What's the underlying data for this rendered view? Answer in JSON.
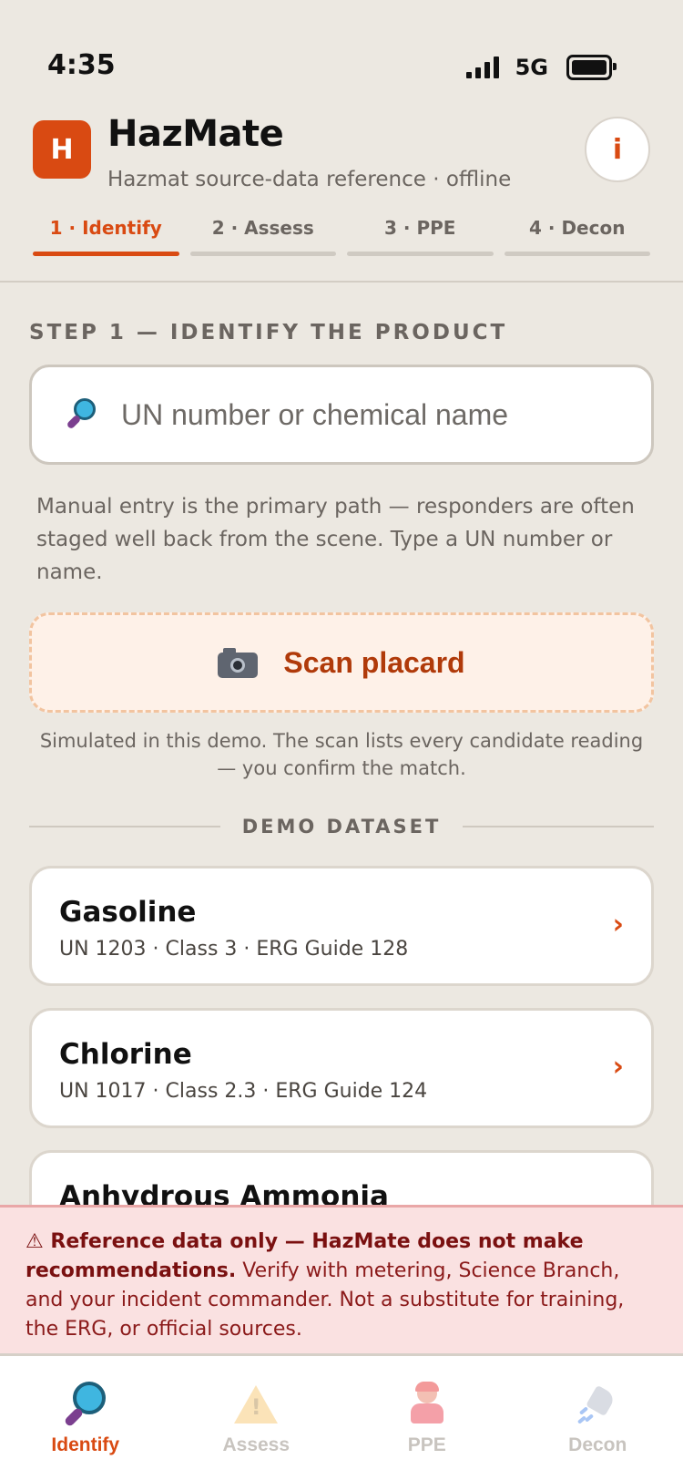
{
  "status_bar": {
    "time": "4:35",
    "network": "5G"
  },
  "header": {
    "logo_letter": "H",
    "title": "HazMate",
    "subtitle": "Hazmat source-data reference · offline",
    "info_label": "i"
  },
  "steps": [
    {
      "label": "1 · Identify",
      "active": true
    },
    {
      "label": "2 · Assess",
      "active": false
    },
    {
      "label": "3 · PPE",
      "active": false
    },
    {
      "label": "4 · Decon",
      "active": false
    }
  ],
  "identify": {
    "heading": "STEP 1 — IDENTIFY THE PRODUCT",
    "search_placeholder": "UN number or chemical name",
    "helper": "Manual entry is the primary path — responders are often staged well back from the scene. Type a UN number or name.",
    "scan_label": "Scan placard",
    "scan_note": "Simulated in this demo. The scan lists every candidate reading — you confirm the match."
  },
  "dataset": {
    "label": "DEMO DATASET",
    "items": [
      {
        "name": "Gasoline",
        "detail": "UN 1203 · Class 3 · ERG Guide 128"
      },
      {
        "name": "Chlorine",
        "detail": "UN 1017 · Class 2.3 · ERG Guide 124"
      },
      {
        "name": "Anhydrous Ammonia",
        "detail": ""
      }
    ],
    "chevron": "›"
  },
  "disclaimer": {
    "bold": "⚠ Reference data only — HazMate does not make recommendations.",
    "text": " Verify with metering, Science Branch, and your incident commander. Not a substitute for training, the ERG, or official sources."
  },
  "bottom_nav": [
    {
      "label": "Identify",
      "icon": "magnifier-icon",
      "active": true
    },
    {
      "label": "Assess",
      "icon": "warning-icon",
      "active": false
    },
    {
      "label": "PPE",
      "icon": "responder-icon",
      "active": false
    },
    {
      "label": "Decon",
      "icon": "shower-icon",
      "active": false
    }
  ],
  "colors": {
    "accent": "#D94A12",
    "background": "#ECE8E1",
    "warning_bg": "#FAE1E1"
  }
}
